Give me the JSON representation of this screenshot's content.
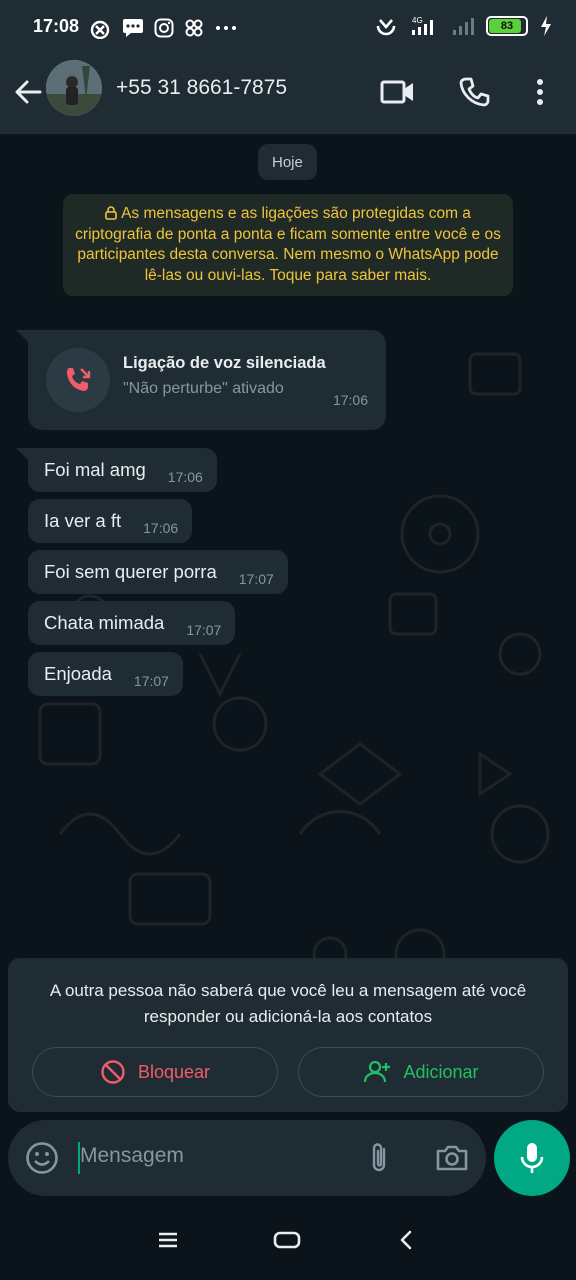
{
  "status_bar": {
    "time": "17:08",
    "battery_level": "83",
    "network": "4G",
    "notification_icons": [
      "missed-call-icon",
      "chat-icon",
      "instagram-icon",
      "app-icon",
      "more-dots-icon"
    ]
  },
  "header": {
    "contact_name": "+55 31 8661-7875",
    "actions": [
      "video-call-icon",
      "voice-call-icon",
      "more-options-icon"
    ]
  },
  "chat": {
    "date_chip": "Hoje",
    "encryption_notice": "As mensagens e as ligações são protegidas com a criptografia de ponta a ponta e ficam somente entre você e os participantes desta conversa. Nem mesmo o WhatsApp pode lê-las ou ouvi-las. Toque para saber mais.",
    "call": {
      "title": "Ligação de voz silenciada",
      "subtitle": "\"Não perturbe\" ativado",
      "time": "17:06"
    },
    "messages": [
      {
        "text": "Foi mal amg",
        "time": "17:06"
      },
      {
        "text": "Ia ver a ft",
        "time": "17:06"
      },
      {
        "text": "Foi sem querer porra",
        "time": "17:07"
      },
      {
        "text": "Chata mimada",
        "time": "17:07"
      },
      {
        "text": "Enjoada",
        "time": "17:07"
      }
    ]
  },
  "unknown_contact": {
    "message": "A outra pessoa não saberá que você leu a mensagem até você responder ou adicioná-la aos contatos",
    "block_label": "Bloquear",
    "add_label": "Adicionar"
  },
  "composer": {
    "placeholder": "Mensagem"
  },
  "colors": {
    "accent": "#00a884",
    "danger": "#f15c6d",
    "bubble": "#1f2c34",
    "background": "#0b141a",
    "notice_text": "#f0c43a"
  }
}
